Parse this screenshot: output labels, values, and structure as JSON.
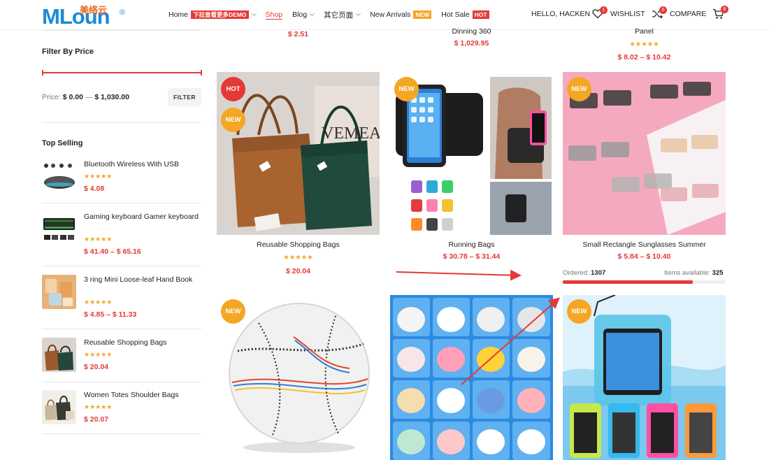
{
  "header": {
    "logo_text": "MLoun",
    "logo_cn": "美络云",
    "logo_reg": "®",
    "nav": [
      {
        "label": "Home",
        "tag": "下拉查看更多DEMO",
        "tag_color": "red",
        "chevron": true,
        "active": false
      },
      {
        "label": "Shop",
        "tag": "",
        "chevron": false,
        "active": true
      },
      {
        "label": "Blog",
        "tag": "",
        "chevron": true,
        "active": false
      },
      {
        "label": "其它页面",
        "tag": "",
        "chevron": true,
        "active": false
      },
      {
        "label": "New Arrivals",
        "tag": "NEW",
        "tag_color": "orange",
        "chevron": false,
        "active": false
      },
      {
        "label": "Hot Sale",
        "tag": "HOT",
        "tag_color": "red",
        "chevron": false,
        "active": false
      }
    ],
    "hello": "HELLO, HACKEN",
    "wishlist_label": "WISHLIST",
    "wishlist_count": "1",
    "compare_label": "COMPARE",
    "compare_count": "0",
    "cart_count": "6"
  },
  "sidebar": {
    "filter_title": "Filter By Price",
    "price_label": "Price:",
    "price_min": "$ 0.00",
    "price_sep": "—",
    "price_max": "$ 1,030.00",
    "filter_button": "FILTER",
    "top_selling_title": "Top Selling",
    "top_selling": [
      {
        "name": "Bluetooth Wireless With USB",
        "stars": "★★★★★",
        "price": "$ 4.08"
      },
      {
        "name": "Gaming keyboard Gamer keyboard",
        "stars": "★★★★★",
        "price": "$ 41.40 – $ 65.16"
      },
      {
        "name": "3 ring Mini Loose-leaf Hand Book",
        "stars": "★★★★★",
        "price": "$ 4.85 – $ 11.33"
      },
      {
        "name": "Reusable Shopping Bags",
        "stars": "★★★★★",
        "price": "$ 20.04"
      },
      {
        "name": "Women Totes Shoulder Bags",
        "stars": "★★★★★",
        "price": "$ 20.07"
      }
    ]
  },
  "top_row": [
    {
      "name": "",
      "price": "$ 2.51"
    },
    {
      "name": "Dinning 360",
      "price": "$ 1,029.95"
    },
    {
      "name": "Panel",
      "stars": "★★★★★",
      "price": "$ 8.02 – $ 10.42"
    }
  ],
  "products": [
    {
      "name": "Reusable Shopping Bags",
      "stars": "★★★★★",
      "price": "$ 20.04",
      "badges": [
        "HOT",
        "NEW"
      ]
    },
    {
      "name": "Running Bags",
      "price": "$ 30.78 – $ 31.44",
      "badges": [
        "NEW"
      ]
    },
    {
      "name": "Small Rectangle Sunglasses Summer",
      "stars": "★★★★★",
      "price": "$ 5.84 – $ 10.40",
      "badges": [
        "NEW"
      ],
      "ordered_label": "Ordered:",
      "ordered": "1307",
      "available_label": "Items available:",
      "available": "325",
      "sold_fraction": 0.8
    },
    {
      "name": "",
      "badges": [
        "NEW"
      ]
    },
    {
      "name": "",
      "badges": []
    },
    {
      "name": "",
      "badges": [
        "NEW"
      ]
    }
  ],
  "colors": {
    "accent": "#e53935",
    "new_badge": "#f5a623",
    "star": "#f5a623",
    "brand_blue": "#1a8ad8"
  }
}
